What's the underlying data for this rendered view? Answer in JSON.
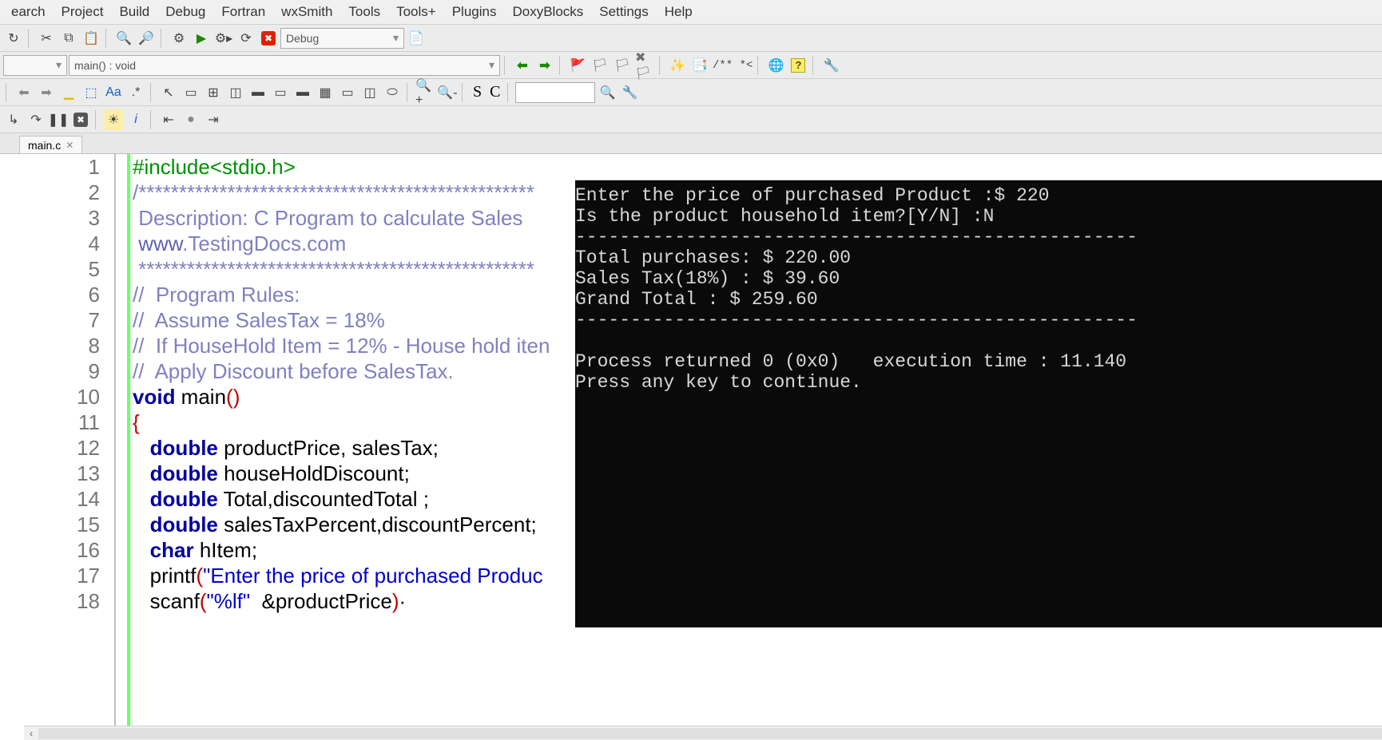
{
  "menubar": [
    "earch",
    "Project",
    "Build",
    "Debug",
    "Fortran",
    "wxSmith",
    "Tools",
    "Tools+",
    "Plugins",
    "DoxyBlocks",
    "Settings",
    "Help"
  ],
  "toolbar1": {
    "config_dropdown": "Debug"
  },
  "toolbar2": {
    "scope_dropdown": "",
    "func_dropdown": "main() : void",
    "comment_label": "/** *<"
  },
  "tab": {
    "name": "main.c"
  },
  "code": {
    "lines": [
      {
        "n": 1,
        "html": "<span class='kw-include'>#include&lt;stdio.h&gt;</span>"
      },
      {
        "n": 2,
        "html": "<span class='cmt-star'>/*************************************************</span>"
      },
      {
        "n": 3,
        "html": "<span class='cmt'> Description: C Program to calculate Sales</span>"
      },
      {
        "n": 4,
        "html": "<span class='cmt'> </span><span class='link'>www</span><span class='cmt'>.TestingDocs.com</span>"
      },
      {
        "n": 5,
        "html": "<span class='cmt-star'> *************************************************</span>"
      },
      {
        "n": 6,
        "html": "<span class='cmt'>//  Program Rules:</span>"
      },
      {
        "n": 7,
        "html": "<span class='cmt'>//  Assume SalesTax = 18%</span>"
      },
      {
        "n": 8,
        "html": "<span class='cmt'>//  If HouseHold Item = 12% - House hold iten</span>"
      },
      {
        "n": 9,
        "html": "<span class='cmt'>//  Apply Discount before SalesTax.</span>"
      },
      {
        "n": 10,
        "html": "<span class='kw'>void</span><span class='black'> main</span><span class='paren'>()</span>"
      },
      {
        "n": 11,
        "html": "<span class='brace'>{</span>"
      },
      {
        "n": 12,
        "html": "   <span class='type'>double</span><span class='black'> productPrice, salesTax;</span>"
      },
      {
        "n": 13,
        "html": "   <span class='type'>double</span><span class='black'> houseHoldDiscount;</span>"
      },
      {
        "n": 14,
        "html": "   <span class='type'>double</span><span class='black'> Total,discountedTotal ;</span>"
      },
      {
        "n": 15,
        "html": "   <span class='type'>double</span><span class='black'> salesTaxPercent,discountPercent;</span>"
      },
      {
        "n": 16,
        "html": "   <span class='type'>char</span><span class='black'> hItem;</span>"
      },
      {
        "n": 17,
        "html": "   <span class='black'>printf</span><span class='paren'>(</span><span class='str'>\"Enter the price of purchased Produc</span>"
      },
      {
        "n": 18,
        "html": "   <span class='black'>scanf</span><span class='paren'>(</span><span class='str'>\"%lf\"</span><span class='black'>  &amp;productPrice</span><span class='paren'>)</span><span class='black'>·</span>"
      }
    ]
  },
  "console": {
    "lines": [
      "Enter the price of purchased Product :$ 220",
      "Is the product household item?[Y/N] :N",
      "---------------------------------------------------",
      "Total purchases: $ 220.00",
      "Sales Tax(18%) : $ 39.60",
      "Grand Total : $ 259.60",
      "---------------------------------------------------",
      "",
      "Process returned 0 (0x0)   execution time : 11.140",
      "Press any key to continue."
    ]
  }
}
